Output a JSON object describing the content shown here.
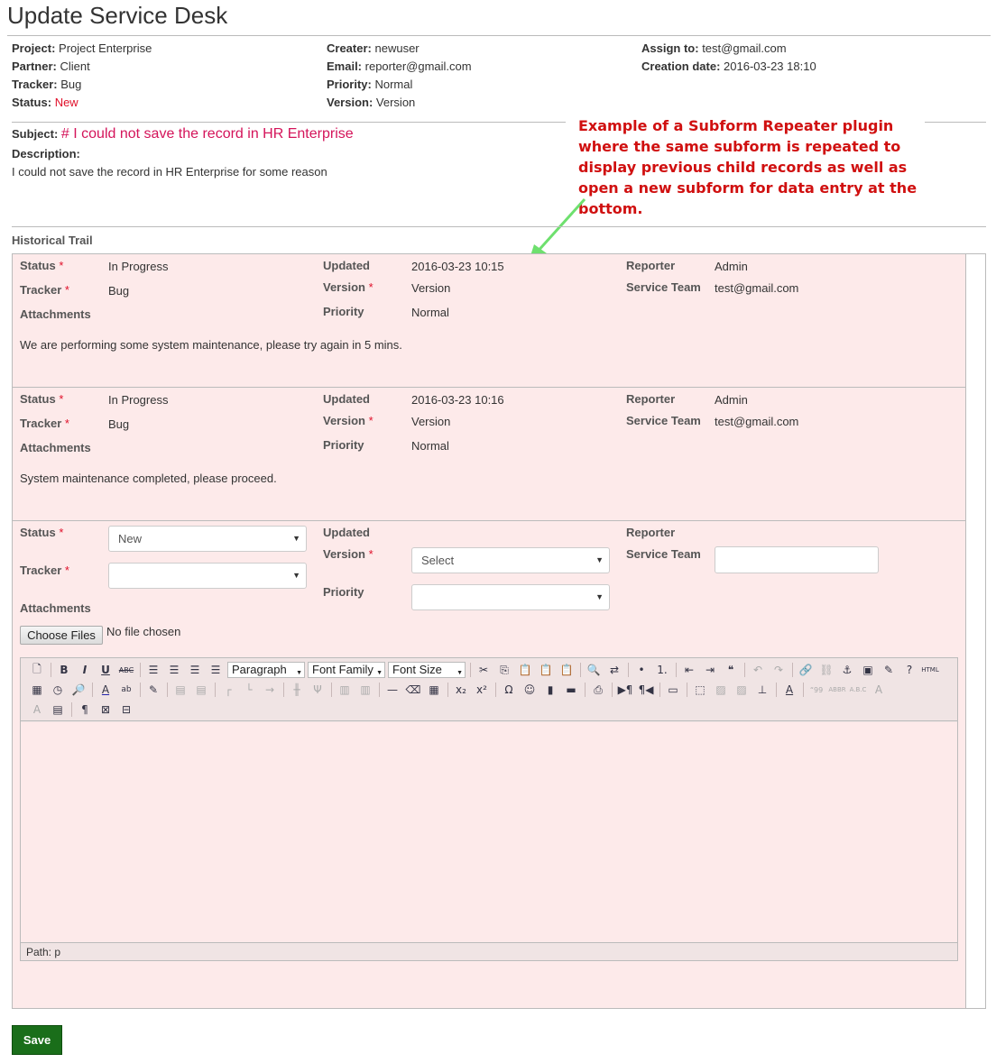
{
  "page": {
    "title": "Update Service Desk"
  },
  "info": {
    "project_label": "Project:",
    "project": "Project Enterprise",
    "partner_label": "Partner:",
    "partner": "Client",
    "tracker_label": "Tracker:",
    "tracker": "Bug",
    "status_label": "Status:",
    "status": "New",
    "creater_label": "Creater:",
    "creater": "newuser",
    "email_label": "Email:",
    "email": "reporter@gmail.com",
    "priority_label": "Priority:",
    "priority": "Normal",
    "version_label": "Version:",
    "version": "Version",
    "assign_label": "Assign to:",
    "assign": "test@gmail.com",
    "created_label": "Creation date:",
    "created": "2016-03-23 18:10",
    "subject_label": "Subject:",
    "subject": "# I could not save the record in HR Enterprise",
    "description_label": "Description:",
    "description": "I could not save the record in HR Enterprise for some reason"
  },
  "callout": "Example of a Subform Repeater plugin where the same subform is repeated to display previous child records as well as open a new subform for data entry at the bottom.",
  "history": {
    "label": "Historical Trail",
    "labels": {
      "status": "Status",
      "tracker": "Tracker",
      "attachments": "Attachments",
      "updated": "Updated",
      "version": "Version",
      "priority": "Priority",
      "reporter": "Reporter",
      "service_team": "Service Team",
      "req": "*"
    },
    "records": [
      {
        "status": "In Progress",
        "tracker": "Bug",
        "updated": "2016-03-23 10:15",
        "version": "Version",
        "priority": "Normal",
        "reporter": "Admin",
        "service_team": "test@gmail.com",
        "note": "We are performing some system maintenance, please try again in 5 mins."
      },
      {
        "status": "In Progress",
        "tracker": "Bug",
        "updated": "2016-03-23 10:16",
        "version": "Version",
        "priority": "Normal",
        "reporter": "Admin",
        "service_team": "test@gmail.com",
        "note": "System maintenance completed, please proceed."
      }
    ],
    "new_form": {
      "status_value": "New",
      "tracker_value": "",
      "version_value": "Select",
      "priority_value": "",
      "choose_files": "Choose Files",
      "no_file": "No file chosen"
    }
  },
  "editor": {
    "paragraph": "Paragraph",
    "font_family": "Font Family",
    "font_size": "Font Size",
    "path": "Path: p"
  },
  "save_label": "Save"
}
